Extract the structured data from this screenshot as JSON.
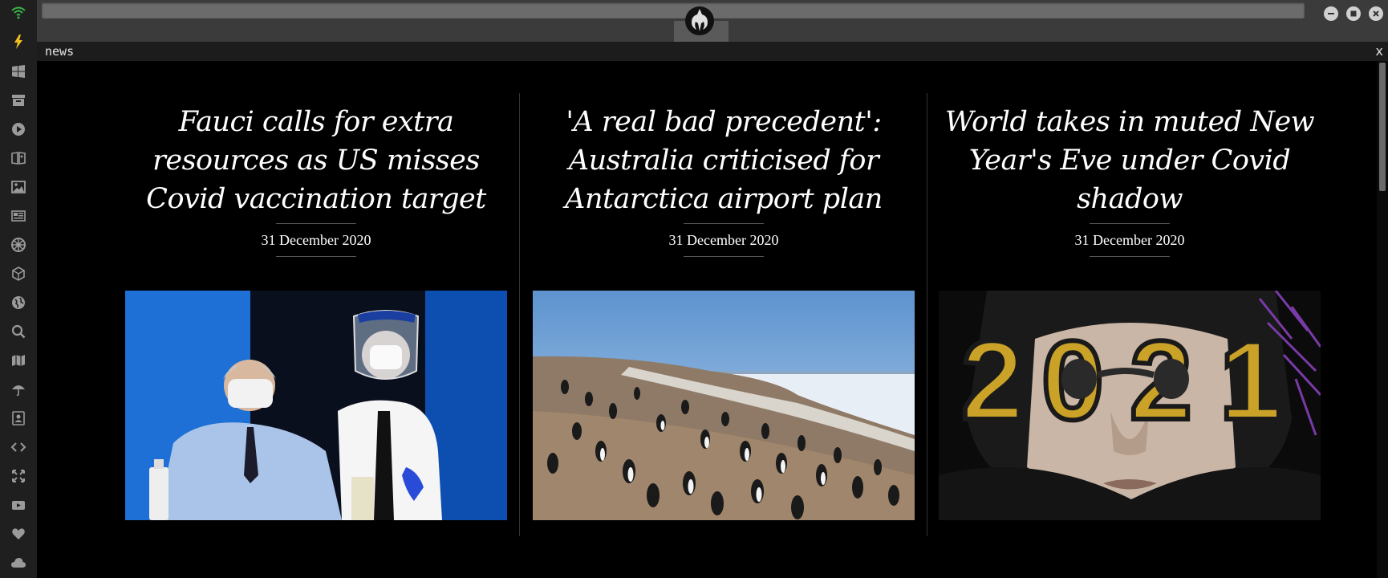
{
  "sidebar": {
    "items": [
      {
        "icon": "wifi-icon",
        "color": "#3bb54a"
      },
      {
        "icon": "lightning-icon",
        "color": "#f0c020"
      },
      {
        "icon": "windows-icon",
        "color": "#9a9a9a"
      },
      {
        "icon": "archive-icon",
        "color": "#9a9a9a"
      },
      {
        "icon": "play-icon",
        "color": "#9a9a9a"
      },
      {
        "icon": "book-icon",
        "color": "#9a9a9a"
      },
      {
        "icon": "image-icon",
        "color": "#9a9a9a"
      },
      {
        "icon": "newspaper-icon",
        "color": "#9a9a9a"
      },
      {
        "icon": "empire-icon",
        "color": "#9a9a9a"
      },
      {
        "icon": "cube-icon",
        "color": "#9a9a9a"
      },
      {
        "icon": "globe-icon",
        "color": "#9a9a9a"
      },
      {
        "icon": "search-icon",
        "color": "#9a9a9a"
      },
      {
        "icon": "map-icon",
        "color": "#9a9a9a"
      },
      {
        "icon": "umbrella-icon",
        "color": "#9a9a9a"
      },
      {
        "icon": "contacts-icon",
        "color": "#9a9a9a"
      },
      {
        "icon": "code-icon",
        "color": "#9a9a9a"
      },
      {
        "icon": "expand-icon",
        "color": "#9a9a9a"
      },
      {
        "icon": "youtube-icon",
        "color": "#9a9a9a"
      },
      {
        "icon": "heart-icon",
        "color": "#9a9a9a"
      },
      {
        "icon": "cloud-icon",
        "color": "#9a9a9a"
      }
    ]
  },
  "panel": {
    "title": "news",
    "close": "x"
  },
  "articles": [
    {
      "headline": "Fauci calls for extra resources as US misses Covid vaccination target",
      "date": "31 December 2020",
      "image": "photo of Fauci receiving vaccine"
    },
    {
      "headline": "'A real bad precedent': Australia criticised for Antarctica airport plan",
      "date": "31 December 2020",
      "image": "photo of penguin colony"
    },
    {
      "headline": "World takes in muted New Year's Eve under Covid shadow",
      "date": "31 December 2020",
      "image": "photo of mannequin in 2021 glasses"
    }
  ],
  "colors": {
    "accent_wifi": "#3bb54a",
    "accent_bolt": "#f0c020",
    "background": "#000000"
  }
}
